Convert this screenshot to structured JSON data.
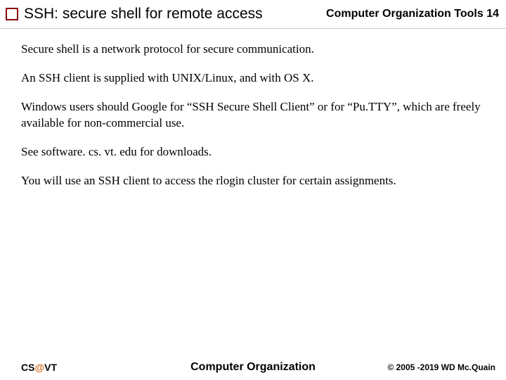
{
  "header": {
    "title": "SSH: secure shell for remote access",
    "section": "Computer Organization Tools",
    "page_number": "14"
  },
  "content": {
    "p1": "Secure shell is a network protocol for secure communication.",
    "p2": "An SSH client is supplied with UNIX/Linux, and with OS X.",
    "p3": "Windows users should Google for “SSH Secure Shell Client” or for “Pu.TTY”, which are freely available for non-commercial use.",
    "p4": "See software. cs. vt. edu for downloads.",
    "p5": "You will use an SSH client to access the rlogin cluster for certain assignments."
  },
  "footer": {
    "left_prefix": "CS",
    "left_at": "@",
    "left_suffix": "VT",
    "center": "Computer Organization",
    "right": "© 2005 -2019 WD Mc.Quain"
  }
}
